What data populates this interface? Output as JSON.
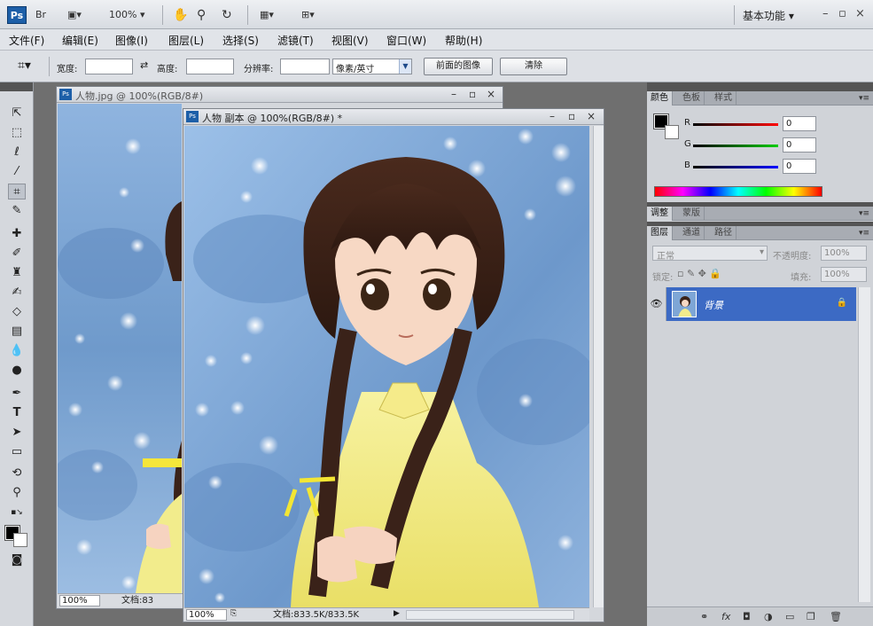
{
  "appbar": {
    "logo": "Ps",
    "zoom": "100%",
    "workspace": "基本功能",
    "icons": [
      "bridge-icon",
      "view-mode-icon",
      "hand-icon",
      "zoom-icon",
      "rotate-icon",
      "arrange-docs-icon",
      "screen-mode-icon"
    ],
    "window_controls": [
      "–",
      "▫",
      "×"
    ]
  },
  "menubar": {
    "items": [
      "文件(F)",
      "编辑(E)",
      "图像(I)",
      "图层(L)",
      "选择(S)",
      "滤镜(T)",
      "视图(V)",
      "窗口(W)",
      "帮助(H)"
    ]
  },
  "optbar": {
    "width_label": "宽度:",
    "width_value": "",
    "height_label": "高度:",
    "height_value": "",
    "resolution_label": "分辨率:",
    "resolution_value": "",
    "unit_select": "像素/英寸",
    "front_image_button": "前面的图像",
    "clear_button": "清除"
  },
  "doc_back": {
    "title": "人物.jpg @ 100%(RGB/8#)",
    "zoom": "100%",
    "doc_info": "文档:83"
  },
  "doc_front": {
    "title": "人物 副本 @ 100%(RGB/8#) *",
    "zoom": "100%",
    "doc_info": "文档:833.5K/833.5K"
  },
  "color_panel": {
    "tabs": [
      "颜色",
      "色板",
      "样式"
    ],
    "channels": [
      {
        "label": "R",
        "value": "0",
        "color": "#cc0000"
      },
      {
        "label": "G",
        "value": "0",
        "color": "#009900"
      },
      {
        "label": "B",
        "value": "0",
        "color": "#0000cc"
      }
    ]
  },
  "adjust_panel": {
    "tabs": [
      "调整",
      "蒙版"
    ]
  },
  "layers_panel": {
    "tabs": [
      "图层",
      "通道",
      "路径"
    ],
    "blend_mode": "正常",
    "opacity_label": "不透明度:",
    "opacity_value": "100%",
    "lock_label": "锁定:",
    "fill_label": "填充:",
    "fill_value": "100%",
    "layer_name": "背景"
  },
  "colors": {
    "accent": "#3c6ac4",
    "canvas_bg": "#7fa6d4"
  }
}
